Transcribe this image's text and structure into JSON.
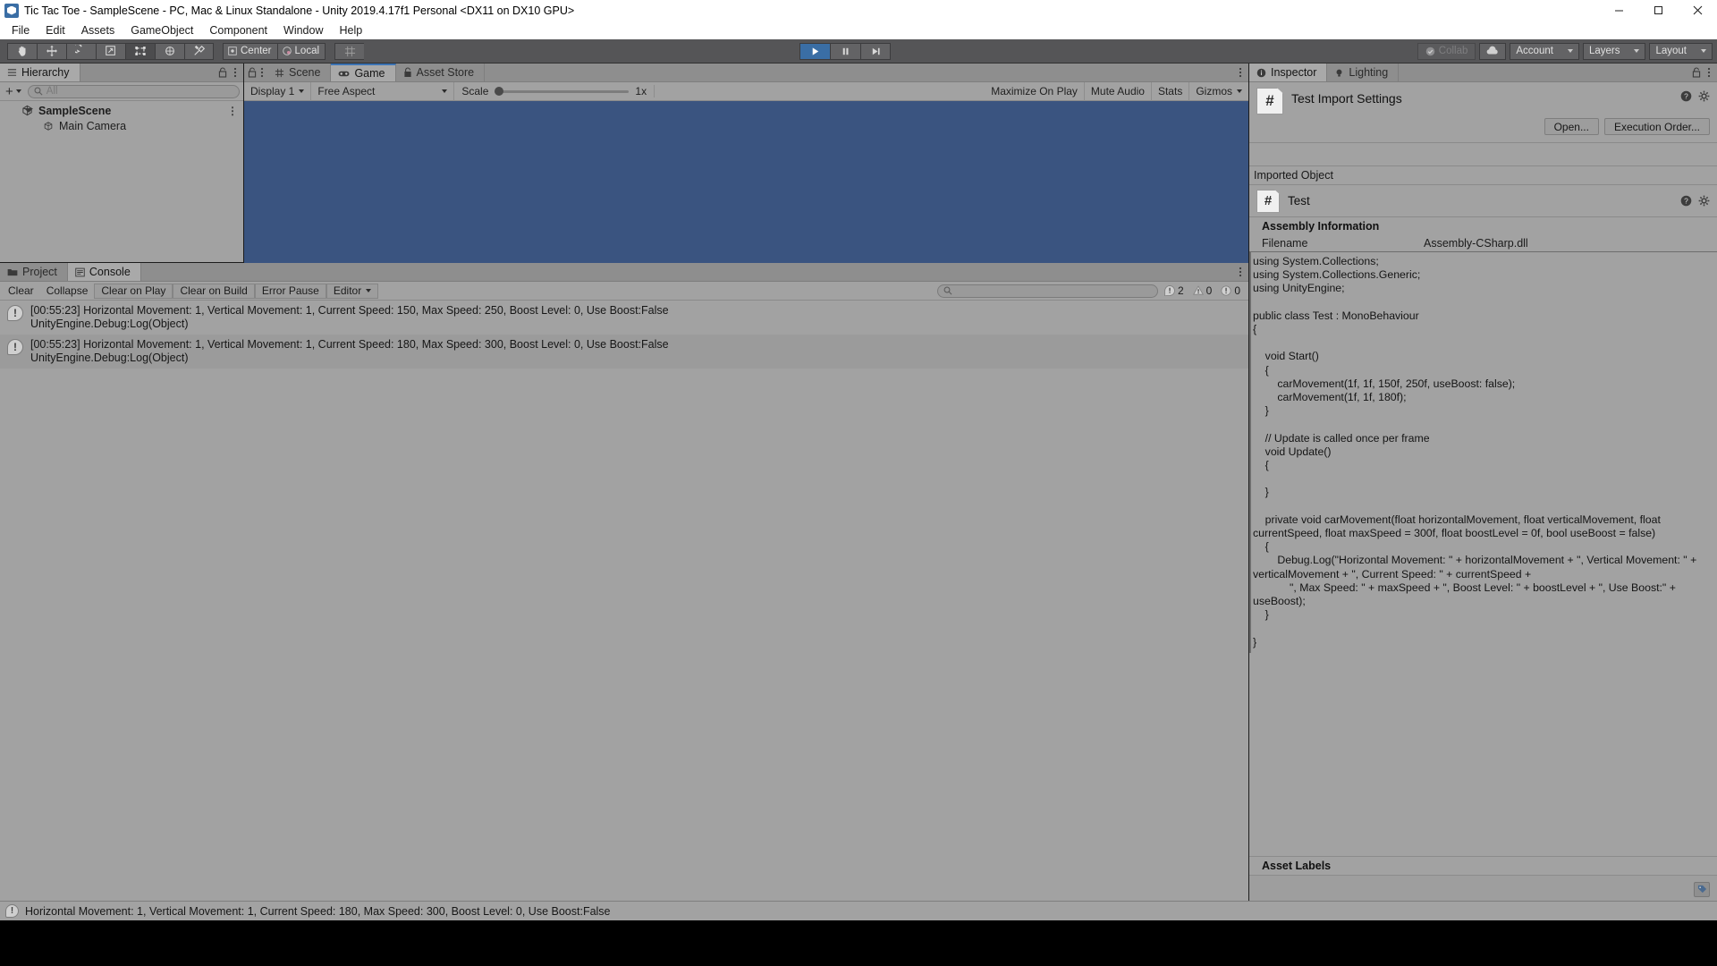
{
  "window": {
    "title": "Tic Tac Toe - SampleScene - PC, Mac & Linux Standalone - Unity 2019.4.17f1 Personal <DX11 on DX10 GPU>",
    "minimize": "minimize-icon",
    "maximize": "maximize-icon",
    "close": "close-icon"
  },
  "menubar": {
    "items": [
      "File",
      "Edit",
      "Assets",
      "GameObject",
      "Component",
      "Window",
      "Help"
    ]
  },
  "toolbar": {
    "tools": [
      "hand-tool",
      "move-tool",
      "rotate-tool",
      "scale-tool",
      "rect-tool",
      "transform-tool",
      "custom-tool"
    ],
    "pivot_label": "Center",
    "space_label": "Local",
    "grid_label": "grid-snap-icon",
    "play_label": "play-button",
    "pause_label": "pause-button",
    "step_label": "step-button",
    "collab_label": "Collab",
    "cloud_label": "cloud-icon",
    "account_label": "Account",
    "layers_label": "Layers",
    "layout_label": "Layout"
  },
  "hierarchy": {
    "tab_label": "Hierarchy",
    "add_label": "+",
    "search_placeholder": "All",
    "rows": [
      {
        "label": "SampleScene",
        "type": "scene",
        "icon": "scene-icon",
        "expanded": true
      },
      {
        "label": "Main Camera",
        "type": "gameobject",
        "icon": "gameobject-icon"
      }
    ]
  },
  "gameview": {
    "tabs": [
      {
        "label": "Scene",
        "icon": "scene-grid-icon",
        "active": false
      },
      {
        "label": "Game",
        "icon": "gamepad-icon",
        "active": true
      },
      {
        "label": "Asset Store",
        "icon": "store-lock-icon",
        "active": false
      }
    ],
    "display": "Display 1",
    "aspect": "Free Aspect",
    "scale_label": "Scale",
    "scale_value": "1x",
    "maximize_on_play": "Maximize On Play",
    "mute_audio": "Mute Audio",
    "stats": "Stats",
    "gizmos": "Gizmos",
    "canvas_color": "#3a5480"
  },
  "console": {
    "tabs": [
      {
        "label": "Project",
        "icon": "folder-icon",
        "active": false
      },
      {
        "label": "Console",
        "icon": "console-icon",
        "active": true
      }
    ],
    "buttons": [
      "Clear",
      "Collapse",
      "Clear on Play",
      "Clear on Build",
      "Error Pause"
    ],
    "editor_dropdown": "Editor",
    "search_placeholder": "",
    "counts": {
      "info": "2",
      "warning": "0",
      "error": "0"
    },
    "logs": [
      {
        "icon": "info-log-icon",
        "line1": "[00:55:23] Horizontal Movement: 1, Vertical Movement: 1, Current Speed: 150, Max Speed: 250, Boost Level: 0, Use Boost:False",
        "line2": "UnityEngine.Debug:Log(Object)"
      },
      {
        "icon": "info-log-icon",
        "line1": "[00:55:23] Horizontal Movement: 1, Vertical Movement: 1, Current Speed: 180, Max Speed: 300, Boost Level: 0, Use Boost:False",
        "line2": "UnityEngine.Debug:Log(Object)"
      }
    ]
  },
  "inspector": {
    "tabs": [
      {
        "label": "Inspector",
        "icon": "info-circle-icon",
        "active": true
      },
      {
        "label": "Lighting",
        "icon": "light-bulb-icon",
        "active": false
      }
    ],
    "asset_title": "Test Import Settings",
    "open_button": "Open...",
    "execution_order_button": "Execution Order...",
    "imported_object_label": "Imported Object",
    "object_name": "Test",
    "assembly_info_label": "Assembly Information",
    "filename_key": "Filename",
    "filename_value": "Assembly-CSharp.dll",
    "code": "using System.Collections;\nusing System.Collections.Generic;\nusing UnityEngine;\n\npublic class Test : MonoBehaviour\n{\n\n    void Start()\n    {\n        carMovement(1f, 1f, 150f, 250f, useBoost: false);\n        carMovement(1f, 1f, 180f);\n    }\n\n    // Update is called once per frame\n    void Update()\n    {\n\n    }\n\n    private void carMovement(float horizontalMovement, float verticalMovement, float currentSpeed, float maxSpeed = 300f, float boostLevel = 0f, bool useBoost = false)\n    {\n        Debug.Log(\"Horizontal Movement: \" + horizontalMovement + \", Vertical Movement: \" + verticalMovement + \", Current Speed: \" + currentSpeed +\n            \", Max Speed: \" + maxSpeed + \", Boost Level: \" + boostLevel + \", Use Boost:\" + useBoost);\n    }\n\n}",
    "asset_labels_label": "Asset Labels"
  },
  "statusbar": {
    "icon": "info-log-icon",
    "message": "Horizontal Movement: 1, Vertical Movement: 1, Current Speed: 180, Max Speed: 300, Boost Level: 0, Use Boost:False"
  }
}
